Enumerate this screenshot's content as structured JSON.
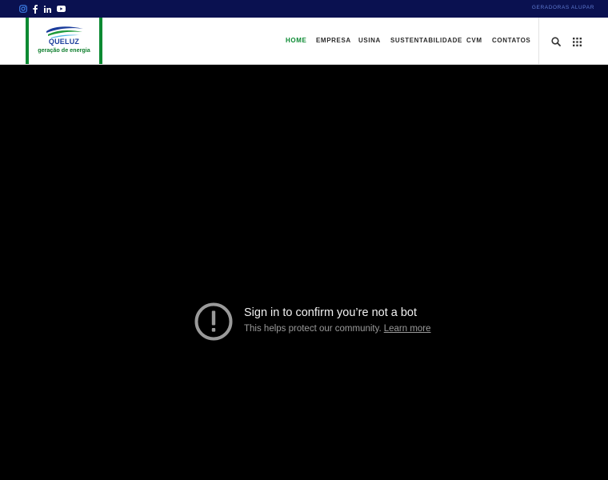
{
  "topbar": {
    "social_icons": [
      "instagram-icon",
      "facebook-icon",
      "linkedin-icon",
      "youtube-icon"
    ],
    "link": "GERADORAS ALUPAR"
  },
  "logo": {
    "name": "QUELUZ",
    "tagline": "geração de energia"
  },
  "nav": {
    "items": [
      {
        "label": "HOME",
        "active": true
      },
      {
        "label": "EMPRESA",
        "active": false
      },
      {
        "label": "USINA",
        "active": false
      },
      {
        "label": "SUSTENTABILIDADE",
        "active": false
      },
      {
        "label": "CVM",
        "active": false
      },
      {
        "label": "CONTATOS",
        "active": false
      }
    ],
    "icons": [
      "search-icon",
      "grid-menu-icon"
    ]
  },
  "video": {
    "title": "Sign in to confirm you’re not a bot",
    "body": "This helps protect our community.",
    "link": "Learn more",
    "icon": "alert-icon"
  },
  "colors": {
    "topbar": "#0a1150",
    "accent_green": "#0b8a32",
    "logo_blue": "#1a3c9c"
  }
}
